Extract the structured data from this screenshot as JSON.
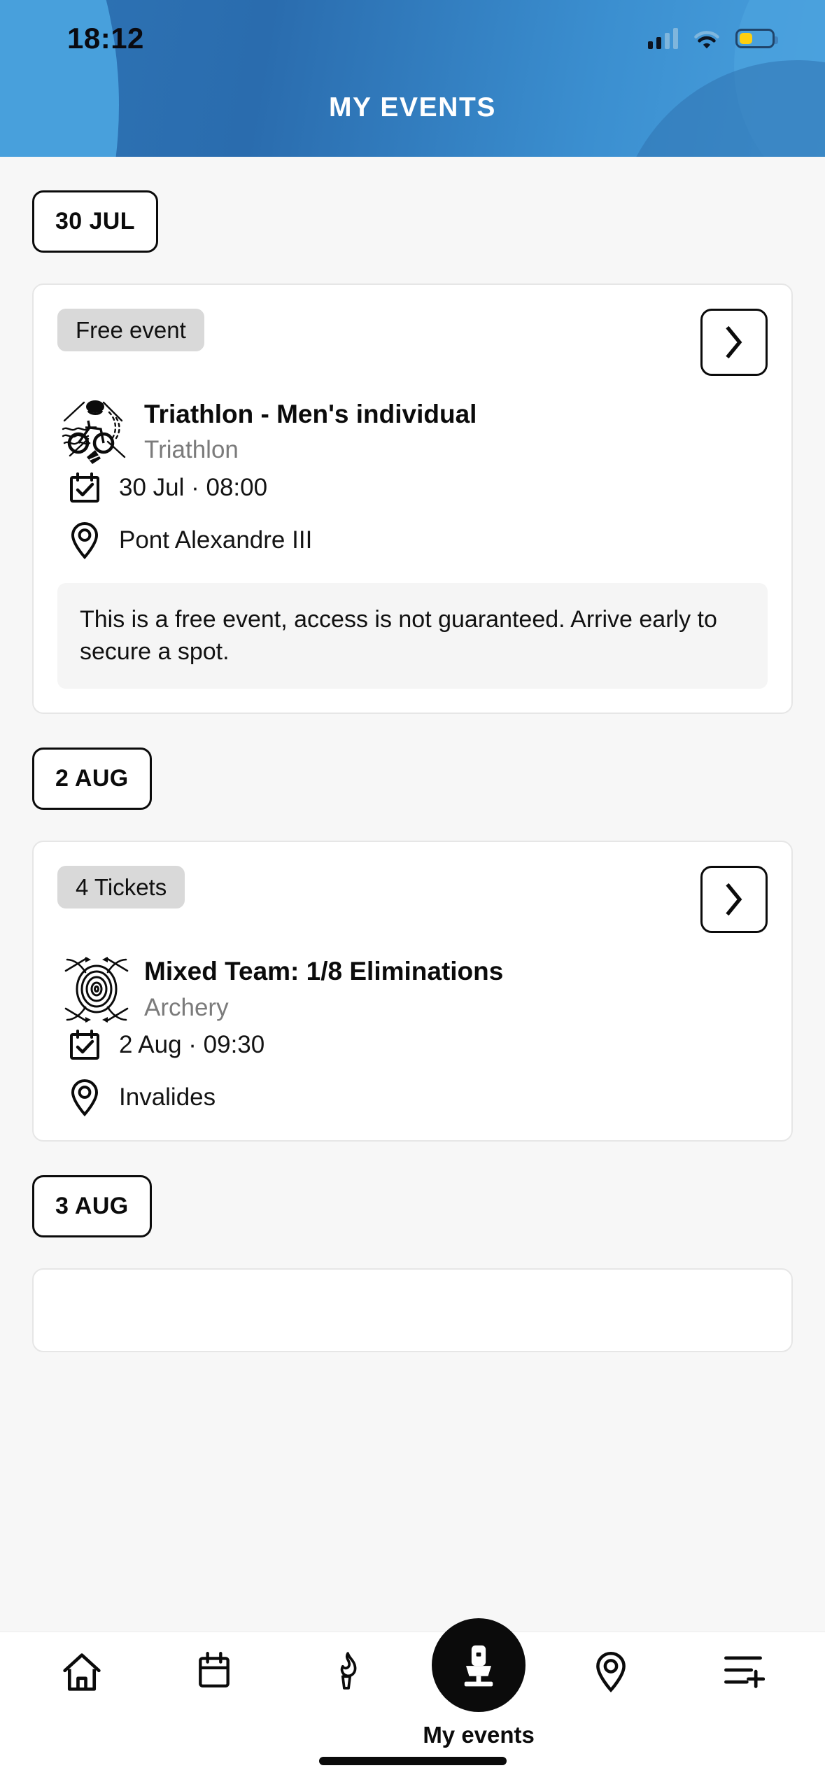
{
  "status_bar": {
    "time": "18:12",
    "signal_icon": "cellular-signal-icon",
    "wifi_icon": "wifi-icon",
    "battery_icon": "battery-low-icon",
    "battery_color": "#ffcf0f"
  },
  "header": {
    "title": "MY EVENTS",
    "bg_color_dark": "#2a6cae",
    "bg_color_light": "#4aa2de",
    "title_color": "#ffffff"
  },
  "sections": [
    {
      "date_chip": "30 JUL",
      "events": [
        {
          "badge": "Free event",
          "sport_icon": "triathlon-pictogram-icon",
          "title": "Triathlon - Men's individual",
          "sport": "Triathlon",
          "datetime": "30 Jul · 08:00",
          "venue": "Pont Alexandre III",
          "notice": "This is a free event, access is not guaranteed. Arrive early to secure a spot.",
          "chevron_icon": "chevron-right-icon",
          "calendar_icon": "calendar-check-icon",
          "location_icon": "location-pin-icon"
        }
      ]
    },
    {
      "date_chip": "2 AUG",
      "events": [
        {
          "badge": "4 Tickets",
          "sport_icon": "archery-target-icon",
          "title": "Mixed Team: 1/8 Eliminations",
          "sport": "Archery",
          "datetime": "2 Aug · 09:30",
          "venue": "Invalides",
          "notice": "",
          "chevron_icon": "chevron-right-icon",
          "calendar_icon": "calendar-check-icon",
          "location_icon": "location-pin-icon"
        }
      ]
    },
    {
      "date_chip": "3 AUG",
      "events": []
    }
  ],
  "tabbar": {
    "items": [
      {
        "icon": "home-icon",
        "label": "",
        "active": false
      },
      {
        "icon": "calendar-icon",
        "label": "",
        "active": false
      },
      {
        "icon": "torch-icon",
        "label": "",
        "active": false
      },
      {
        "icon": "my-events-icon",
        "label": "My events",
        "active": true
      },
      {
        "icon": "location-pin-icon",
        "label": "",
        "active": false
      },
      {
        "icon": "menu-plus-icon",
        "label": "",
        "active": false
      }
    ],
    "active_bg": "#0b0b0b"
  }
}
